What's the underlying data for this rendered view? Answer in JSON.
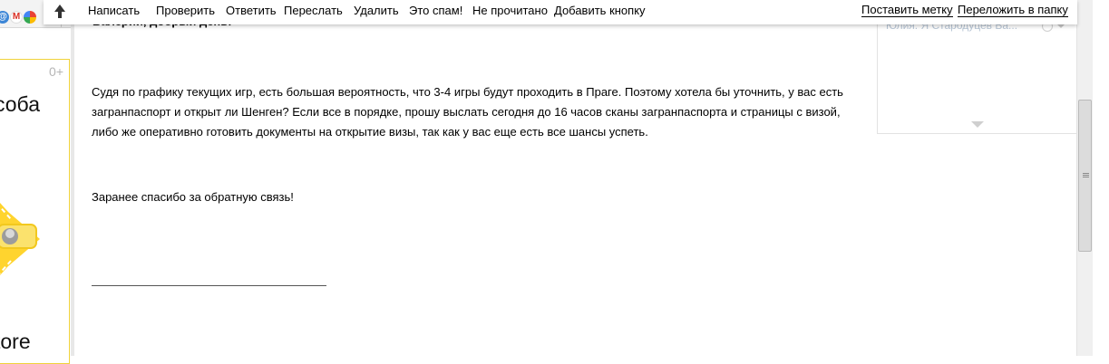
{
  "toolbar": {
    "items": [
      "Написать",
      "Проверить",
      "Ответить",
      "Переслать",
      "Удалить",
      "Это спам!",
      "Не прочитано",
      "Добавить кнопку"
    ],
    "right_items": [
      "Поставить метку",
      "Переложить в папку"
    ]
  },
  "message": {
    "greeting": "Валерий, добрый день!",
    "paragraph1": "Судя по графику текущих игр, есть большая вероятность, что 3-4 игры будут проходить в Праге. Поэтому хотела бы уточнить, у вас есть загранпаспорт и открыт ли Шенген? Если все в порядке, прошу выслать сегодня до 16 часов сканы загранпаспорта и страницы с визой, либо же оперативно готовить документы на открытие визы, так как у вас еще есть все шансы успеть.",
    "paragraph2": "Заранее спасибо за обратную связь!"
  },
  "sidebar": {
    "preview_text": "Юлия: Я Стародуцев Ва..."
  },
  "left_panel": {
    "count": "0+",
    "word_top": "соба",
    "word_bottom": "tore"
  },
  "colors": {
    "promo_yellow": "#ffd42e",
    "promo_border": "#f0d33a"
  }
}
